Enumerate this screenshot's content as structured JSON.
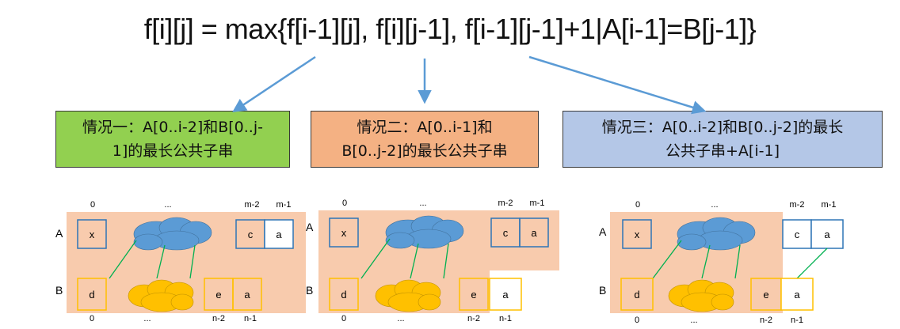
{
  "formula": "f[i][j] = max{f[i-1][j], f[i][j-1], f[i-1][j-1]+1|A[i-1]=B[j-1]}",
  "cases": [
    {
      "line1": "情况一：A[0..i-2]和B[0..j-",
      "line2": "1]的最长公共子串"
    },
    {
      "line1": "情况二：A[0..i-1]和",
      "line2": "B[0..j-2]的最长公共子串"
    },
    {
      "line1": "情况三：A[0..i-2]和B[0..j-2]的最长",
      "line2": "公共子串+A[i-1]"
    }
  ],
  "labels": {
    "row_a": "A",
    "row_b": "B",
    "col_first": "0",
    "col_dots": "...",
    "col_m2": "m-2",
    "col_m1": "m-1",
    "col_n2": "n-2",
    "col_n1": "n-1"
  },
  "cells": {
    "a_first": "x",
    "a_second_last": "c",
    "a_last": "a",
    "b_first": "d",
    "b_second_last": "e",
    "b_last": "a"
  },
  "colors": {
    "arrow": "#5b9bd5",
    "highlight": "#f8cbad",
    "cloud_a": "#5b9bd5",
    "cloud_b": "#ffc000",
    "box_a": "#2e75b6",
    "box_b": "#ffc000",
    "link": "#00b050"
  }
}
